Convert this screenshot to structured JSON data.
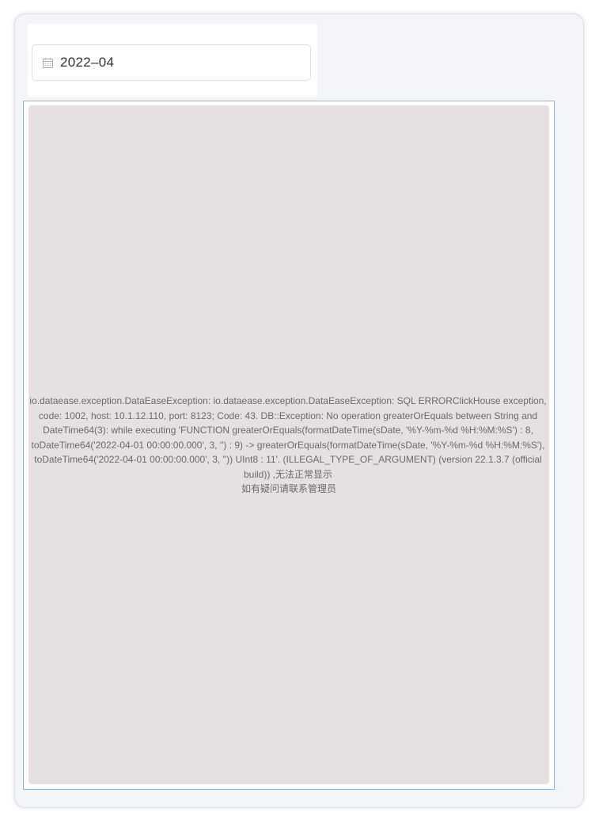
{
  "filter": {
    "date_value": "2022–04",
    "icon": "calendar-icon"
  },
  "chart": {
    "error_message": "io.dataease.exception.DataEaseException: io.dataease.exception.DataEaseException: SQL ERRORClickHouse exception, code: 1002, host: 10.1.12.110, port: 8123; Code: 43. DB::Exception: No operation greaterOrEquals between String and DateTime64(3): while executing 'FUNCTION greaterOrEquals(formatDateTime(sDate, '%Y-%m-%d %H:%M:%S') : 8, toDateTime64('2022-04-01 00:00:00.000', 3, '') : 9) -> greaterOrEquals(formatDateTime(sDate, '%Y-%m-%d %H:%M:%S'), toDateTime64('2022-04-01 00:00:00.000', 3, '')) UInt8 : 11'. (ILLEGAL_TYPE_OF_ARGUMENT) (version 22.1.3.7 (official build)) ,无法正常显示",
    "hint": "如有疑问请联系管理员"
  },
  "colors": {
    "panel_bg": "#f4f5f8",
    "chart_border": "#8cb4e6",
    "chart_bg": "#e6e0e0",
    "text": "#6a6a6a"
  }
}
